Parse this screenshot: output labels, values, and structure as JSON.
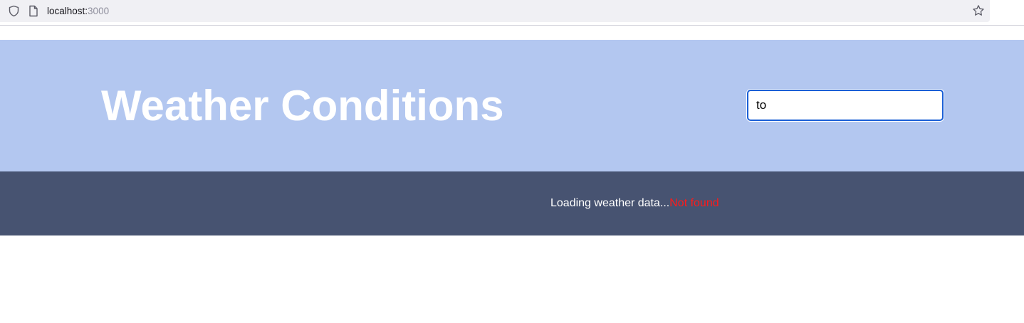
{
  "browser": {
    "url_host": "localhost:",
    "url_port": "3000",
    "icons": {
      "security": "shield-icon",
      "page": "page-icon",
      "bookmark": "star-icon"
    }
  },
  "header": {
    "title": "Weather Conditions",
    "background_color": "#b3c7f0",
    "search": {
      "value": "to",
      "placeholder": ""
    }
  },
  "status": {
    "loading_text": "Loading weather data...",
    "error_text": "Not found",
    "background_color": "#475371",
    "error_color": "#ff1a1a"
  }
}
